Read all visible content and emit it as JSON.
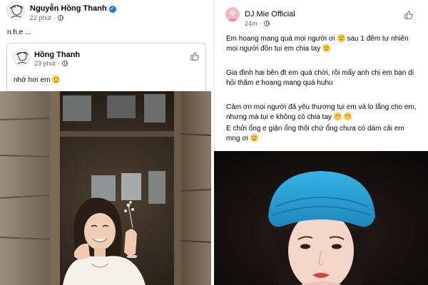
{
  "left_post": {
    "author": "Nguyễn Hồng Thanh",
    "time": "22 phút",
    "text": "n.h.e ...",
    "shared": {
      "author": "Hồng Thanh",
      "time": "23 phút",
      "text": "nhớ hơi em"
    }
  },
  "right_post": {
    "author": "DJ Mie Official",
    "time": "24m",
    "paragraphs": [
      "Em hoang mang quá mọi người ơi",
      "sau 1 đêm tự nhiên mọi người đồn tụi em chia tay",
      "Gia đình hai bên đt em quá chời, rồi mấy anh chị em bạn dì hỏi thăm e hoang mang quá huhu",
      "Cảm ơn mọi người đã yêu thương tụi em và lo lắng cho em, nhưng mà tụi e không có chia tay",
      "E chửi ổng e giận ổng thôi chứ ổng chưa có dám cãi em mng ơi"
    ]
  },
  "icons": {
    "verified": "verified-badge-icon",
    "like": "thumbs-up-icon",
    "globe": "globe-icon"
  },
  "colors": {
    "facebook_blue": "#1877f2",
    "meta_gray": "#65676b",
    "headscarf_blue": "#2fa3d8"
  }
}
